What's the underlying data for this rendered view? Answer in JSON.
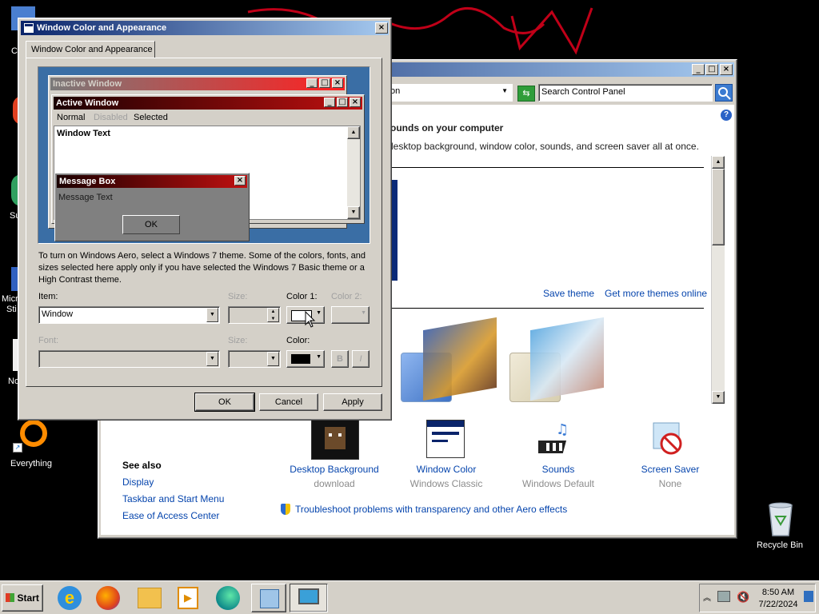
{
  "desktop": {
    "icons": [
      {
        "label": "Everything"
      },
      {
        "label": "Recycle Bin"
      }
    ],
    "partial_labels": [
      "C",
      "Su",
      "Micro",
      "Sti",
      "No"
    ]
  },
  "control_panel": {
    "address_text": "on",
    "search_placeholder": "Search Control Panel",
    "heading": "ounds on your computer",
    "subheading": "desktop background, window color, sounds, and screen saver all at once.",
    "save_theme": "Save theme",
    "get_more_themes": "Get more themes online",
    "see_also_title": "See also",
    "see_also": [
      "Display",
      "Taskbar and Start Menu",
      "Ease of Access Center"
    ],
    "tiles": [
      {
        "label": "Desktop Background",
        "sub": "download"
      },
      {
        "label": "Window Color",
        "sub": "Windows Classic"
      },
      {
        "label": "Sounds",
        "sub": "Windows Default"
      },
      {
        "label": "Screen Saver",
        "sub": "None"
      }
    ],
    "troubleshoot": "Troubleshoot problems with transparency and other Aero effects"
  },
  "dialog": {
    "title": "Window Color and Appearance",
    "tab": "Window Color and Appearance",
    "preview": {
      "inactive_title": "Inactive Window",
      "active_title": "Active Window",
      "menu_normal": "Normal",
      "menu_disabled": "Disabled",
      "menu_selected": "Selected",
      "window_text": "Window Text",
      "msgbox_title": "Message Box",
      "msgbox_text": "Message Text",
      "msgbox_ok": "OK"
    },
    "description": "To turn on Windows Aero, select a Windows 7 theme.  Some of the colors, fonts, and sizes selected here apply only if you have selected the Windows 7 Basic theme or a High Contrast theme.",
    "item_label": "Item:",
    "item_value": "Window",
    "size_label": "Size:",
    "color1_label": "Color 1:",
    "color2_label": "Color 2:",
    "font_label": "Font:",
    "font_size_label": "Size:",
    "font_color_label": "Color:",
    "bold_label": "B",
    "italic_label": "I",
    "ok": "OK",
    "cancel": "Cancel",
    "apply": "Apply"
  },
  "taskbar": {
    "start": "Start",
    "time": "8:50 AM",
    "date": "7/22/2024"
  },
  "colors": {
    "titlebar_active": "#0a246a",
    "preview_bg": "#3a6ea5",
    "preview_active": "#8b0000",
    "preview_inactive": "#ff2020"
  }
}
